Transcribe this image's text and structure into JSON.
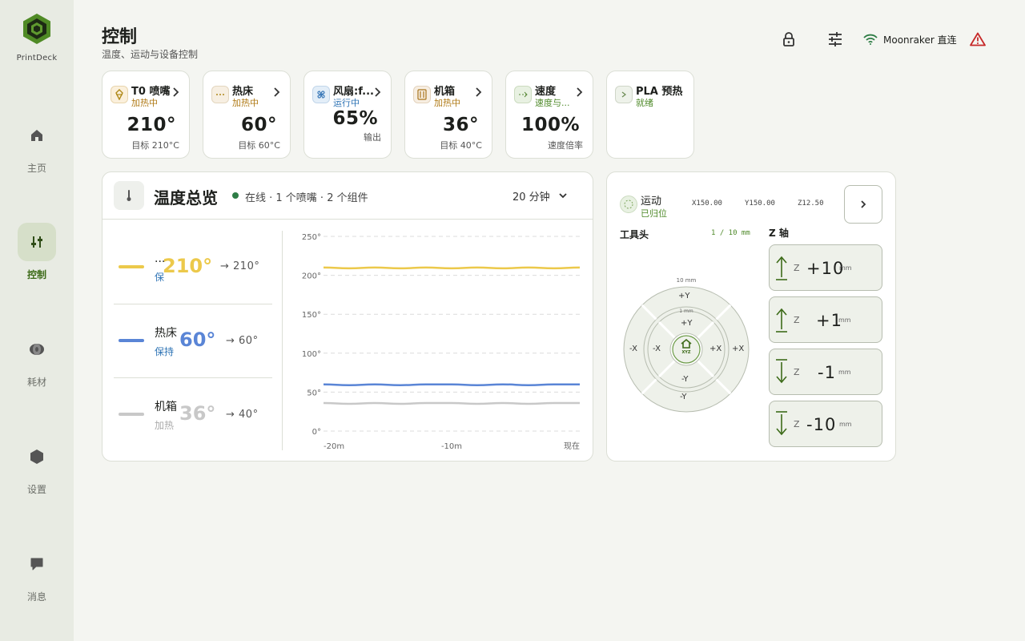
{
  "app": {
    "brand": "PrintDeck"
  },
  "nav": [
    {
      "id": "home",
      "label": "主页",
      "active": false
    },
    {
      "id": "control",
      "label": "控制",
      "active": true
    },
    {
      "id": "filament",
      "label": "耗材",
      "active": false
    },
    {
      "id": "settings",
      "label": "设置",
      "active": false
    },
    {
      "id": "messages",
      "label": "消息",
      "active": false
    }
  ],
  "header": {
    "title": "控制",
    "subtitle": "温度、运动与设备控制",
    "connection": "Moonraker 直连"
  },
  "cards": [
    {
      "name": "T0 喷嘴",
      "status": "加热中",
      "value": "210°",
      "sub": "目标 210°C",
      "icon": "nozzle-icon"
    },
    {
      "name": "热床",
      "status": "加热中",
      "value": "60°",
      "sub": "目标 60°C",
      "icon": "bed-icon"
    },
    {
      "name": "风扇:f...",
      "status": "运行中",
      "value": "65%",
      "sub": "输出",
      "icon": "fan-icon"
    },
    {
      "name": "机箱",
      "status": "加热中",
      "value": "36°",
      "sub": "目标 40°C",
      "icon": "chamber-icon"
    },
    {
      "name": "速度",
      "status": "速度与...",
      "value": "100%",
      "sub": "速度倍率",
      "icon": "speed-icon"
    },
    {
      "name": "PLA 预热",
      "status": "就绪",
      "value": "",
      "sub": "",
      "icon": "preheat-icon"
    }
  ],
  "temp_panel": {
    "title": "温度总览",
    "status": "在线 · 1 个喷嘴 · 2 个组件",
    "range": "20 分钟",
    "rows": [
      {
        "name": "...",
        "state": "保",
        "current": "210°",
        "target": "→  210°",
        "color": "#ecc94b"
      },
      {
        "name": "热床",
        "state": "保持",
        "current": "60°",
        "target": "→  60°",
        "color": "#5a85d6"
      },
      {
        "name": "机箱",
        "state": "加热",
        "current": "36°",
        "target": "→  40°",
        "color": "#c8c8c8"
      }
    ]
  },
  "chart_data": {
    "type": "line",
    "y_ticks": [
      "0°",
      "50°",
      "100°",
      "150°",
      "200°",
      "250°"
    ],
    "x_ticks": [
      "-20m",
      "-10m",
      "现在"
    ],
    "ylim": [
      0,
      250
    ],
    "xlim": [
      -20,
      0
    ],
    "series": [
      {
        "color": "#ecc94b",
        "x": [
          -20,
          -18,
          -16,
          -14,
          -12,
          -10,
          -8,
          -6,
          -4,
          -2,
          0
        ],
        "y": [
          210,
          209,
          210,
          209,
          210,
          209,
          210,
          209,
          210,
          209,
          210
        ]
      },
      {
        "color": "#5a85d6",
        "x": [
          -20,
          -18,
          -16,
          -14,
          -12,
          -10,
          -8,
          -6,
          -4,
          -2,
          0
        ],
        "y": [
          60,
          59,
          60,
          59,
          60,
          60,
          59,
          60,
          59,
          60,
          60
        ]
      },
      {
        "color": "#c8c8c8",
        "x": [
          -20,
          -18,
          -16,
          -14,
          -12,
          -10,
          -8,
          -6,
          -4,
          -2,
          0
        ],
        "y": [
          36,
          35,
          36,
          35,
          36,
          36,
          35,
          36,
          35,
          36,
          36
        ]
      }
    ]
  },
  "motion": {
    "title": "运动",
    "status": "已归位",
    "x": "X150.00",
    "y": "Y150.00",
    "z": "Z12.50",
    "toolhead_label": "工具头",
    "step_label": "1 / 10 mm",
    "z_axis_label": "Z 轴",
    "outer_step": "10 mm",
    "inner_step": "1 mm",
    "jog": {
      "py": "+Y",
      "ny": "-Y",
      "px": "+X",
      "nx": "-X",
      "home": "XYZ"
    },
    "z_buttons": [
      {
        "axis": "Z",
        "value": "+10",
        "unit": "mm",
        "dir": "up"
      },
      {
        "axis": "Z",
        "value": "+1",
        "unit": "mm",
        "dir": "up"
      },
      {
        "axis": "Z",
        "value": "-1",
        "unit": "mm",
        "dir": "down"
      },
      {
        "axis": "Z",
        "value": "-10",
        "unit": "mm",
        "dir": "down"
      }
    ]
  }
}
